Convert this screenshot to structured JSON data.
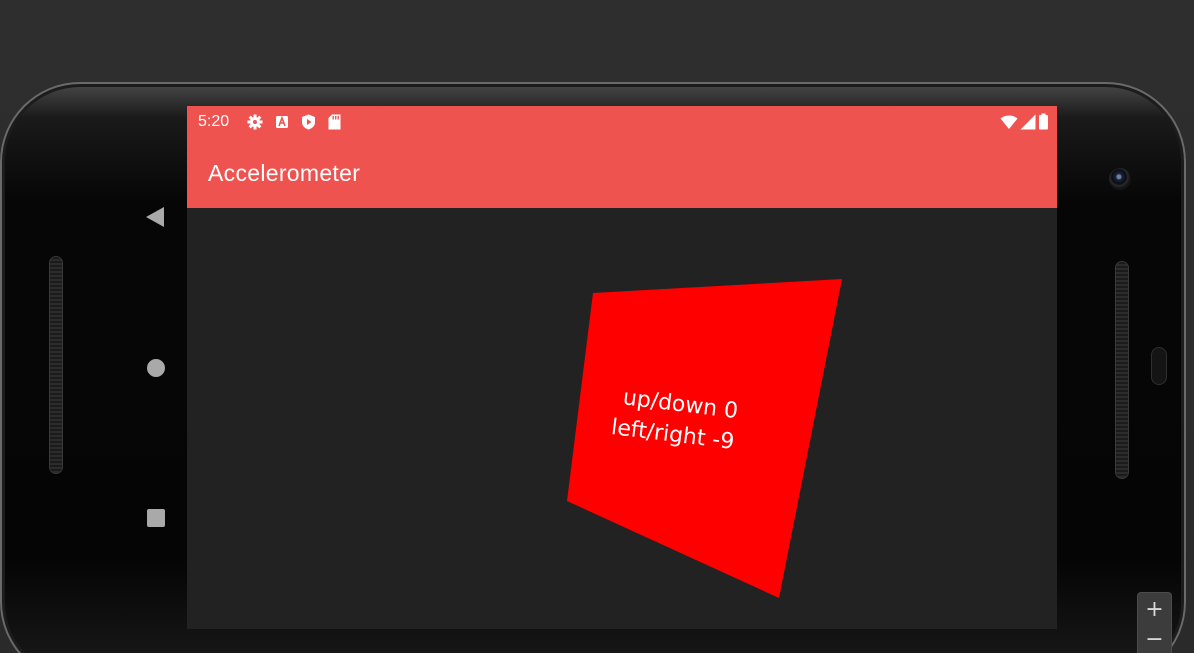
{
  "status_bar": {
    "time": "5:20",
    "left_icons": [
      "gear-icon",
      "a-letter-icon",
      "shield-icon",
      "sd-card-icon"
    ],
    "right_icons": [
      "wifi-icon",
      "cell-signal-icon",
      "battery-icon"
    ]
  },
  "app_bar": {
    "title": "Accelerometer",
    "color": "#ef5350"
  },
  "accelerometer": {
    "up_down_label": "up/down 0",
    "left_right_label": "left/right -9",
    "up_down_value": 0,
    "left_right_value": -9,
    "card_color": "#ff0000"
  },
  "nav_bar": {
    "buttons": [
      "back-icon",
      "home-icon",
      "recents-icon"
    ]
  },
  "zoom_controls": {
    "zoom_in": "+",
    "zoom_out": "−"
  }
}
